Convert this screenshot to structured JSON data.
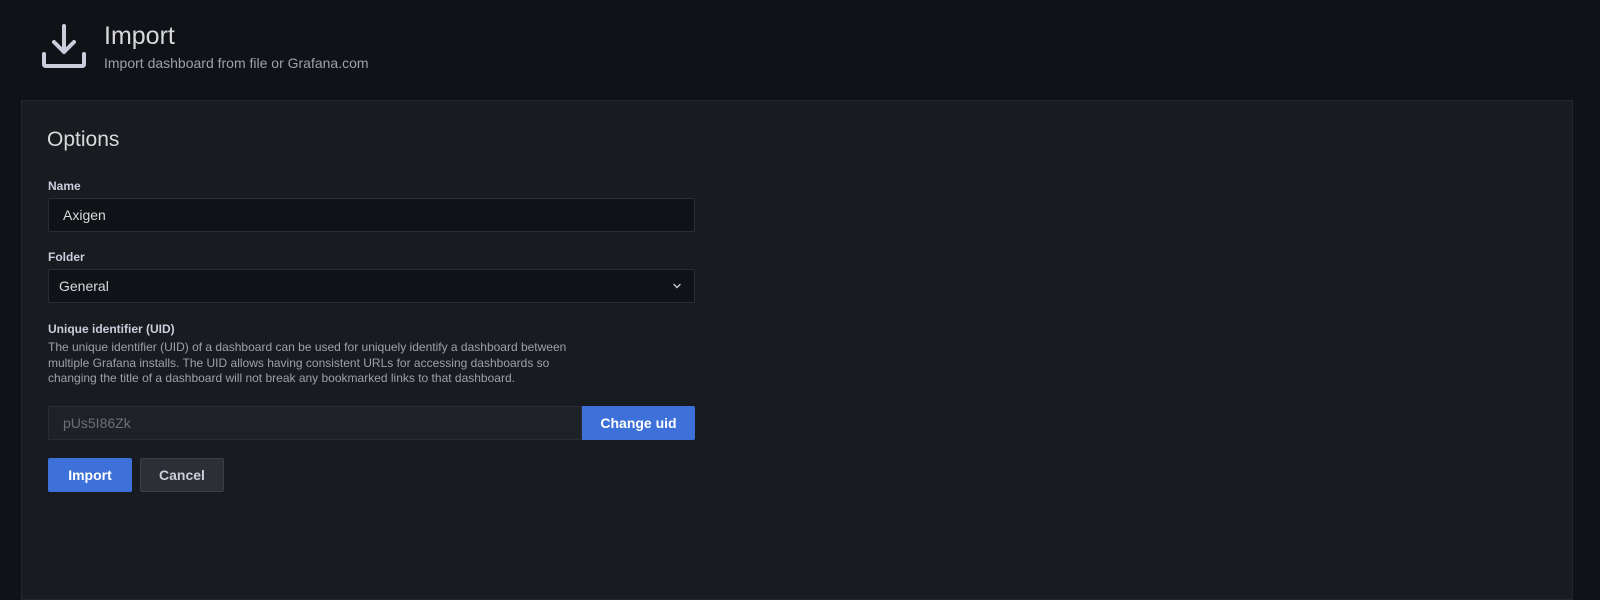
{
  "header": {
    "icon": "download-icon",
    "title": "Import",
    "subtitle": "Import dashboard from file or Grafana.com"
  },
  "options": {
    "title": "Options",
    "name": {
      "label": "Name",
      "value": "Axigen"
    },
    "folder": {
      "label": "Folder",
      "value": "General",
      "icon": "chevron-down-icon"
    },
    "uid": {
      "label": "Unique identifier (UID)",
      "description": "The unique identifier (UID) of a dashboard can be used for uniquely identify a dashboard between multiple Grafana installs. The UID allows having consistent URLs for accessing dashboards so changing the title of a dashboard will not break any bookmarked links to that dashboard.",
      "value": "pUs5I86Zk",
      "change_label": "Change uid"
    }
  },
  "actions": {
    "import_label": "Import",
    "cancel_label": "Cancel"
  },
  "colors": {
    "background": "#111217",
    "panel": "#181b1f",
    "primary": "#3d71d9",
    "secondary": "#2d2f36"
  }
}
